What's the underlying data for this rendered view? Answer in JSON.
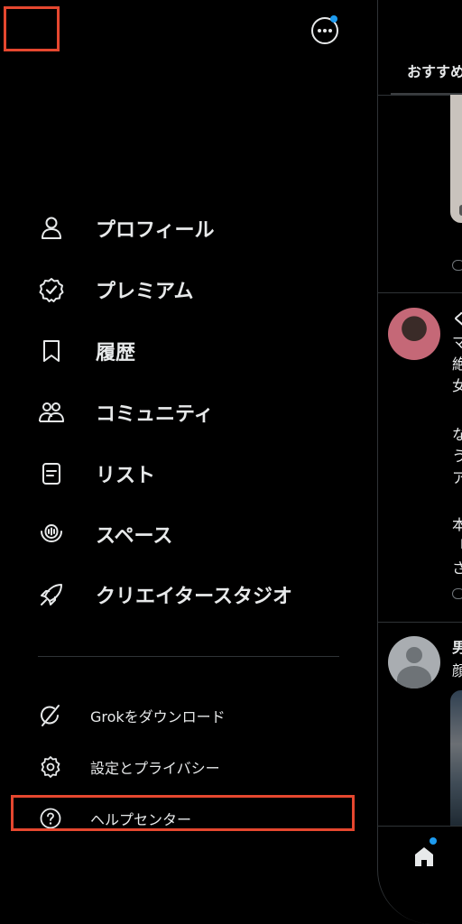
{
  "drawer": {
    "main_items": [
      {
        "label": "プロフィール",
        "icon": "person-icon"
      },
      {
        "label": "プレミアム",
        "icon": "verified-badge-icon"
      },
      {
        "label": "履歴",
        "icon": "bookmark-icon"
      },
      {
        "label": "コミュニティ",
        "icon": "communities-icon"
      },
      {
        "label": "リスト",
        "icon": "list-icon"
      },
      {
        "label": "スペース",
        "icon": "spaces-icon"
      },
      {
        "label": "クリエイタースタジオ",
        "icon": "rocket-icon"
      }
    ],
    "sub_items": [
      {
        "label": "Grokをダウンロード",
        "icon": "grok-icon"
      },
      {
        "label": "設定とプライバシー",
        "icon": "gear-icon"
      },
      {
        "label": "ヘルプセンター",
        "icon": "help-icon"
      }
    ],
    "more_button_icon": "more-icon",
    "accent_color": "#1d9bf0",
    "highlight_color": "#e5472f"
  },
  "background": {
    "tab_label": "おすすめ",
    "tweet_1_chars": [
      "く",
      "マ",
      "絶",
      "女",
      "な",
      "う",
      "ア",
      "本",
      "「",
      "さ"
    ],
    "tweet_2_chars": [
      "男",
      "顔"
    ],
    "nav_icon": "home-icon"
  }
}
